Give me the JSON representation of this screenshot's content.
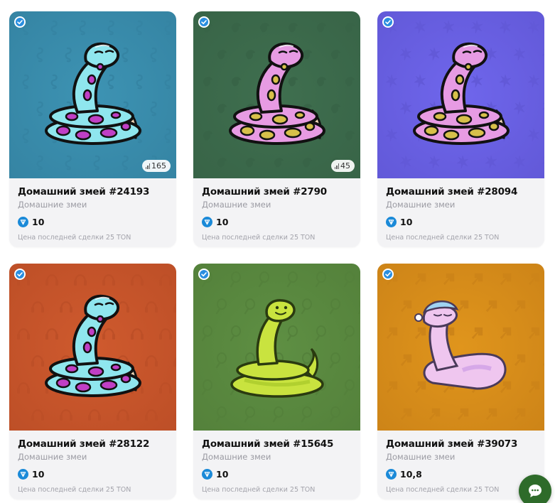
{
  "cards": [
    {
      "title": "Домашний змей #24193",
      "collection": "Домашние змеи",
      "price": "10",
      "last_deal": "Цена последней сделки 25 TON",
      "views": "165",
      "bg_color": "#3d93b3",
      "bg_pattern_color": "#3584a3",
      "snake_body": "#8fe6ee",
      "snake_spots": "#c03fc5",
      "snake_style": "coil",
      "pattern_icon": "seahorse-icon"
    },
    {
      "title": "Домашний змей #2790",
      "collection": "Домашние змеи",
      "price": "10",
      "last_deal": "Цена последней сделки 25 TON",
      "views": "45",
      "bg_color": "#3f6f4f",
      "bg_pattern_color": "#386447",
      "snake_body": "#e79be3",
      "snake_spots": "#d7c04a",
      "snake_style": "coil",
      "pattern_icon": "parrot-icon"
    },
    {
      "title": "Домашний змей #28094",
      "collection": "Домашние змеи",
      "price": "10",
      "last_deal": "Цена последней сделки 25 TON",
      "views": "",
      "bg_color": "#6f66ec",
      "bg_pattern_color": "#6259d8",
      "snake_body": "#e79be3",
      "snake_spots": "#d7c04a",
      "snake_style": "coil",
      "pattern_icon": "leaf-icon"
    },
    {
      "title": "Домашний змей #28122",
      "collection": "Домашние змеи",
      "price": "10",
      "last_deal": "Цена последней сделки 25 TON",
      "views": "",
      "bg_color": "#cf5a2e",
      "bg_pattern_color": "#bd4f27",
      "snake_body": "#8fe6ee",
      "snake_spots": "#c03fc5",
      "snake_style": "coil",
      "pattern_icon": "headphones-icon"
    },
    {
      "title": "Домашний змей #15645",
      "collection": "Домашние змеи",
      "price": "10",
      "last_deal": "Цена последней сделки 25 TON",
      "views": "",
      "bg_color": "#5e8f43",
      "bg_pattern_color": "#54813b",
      "snake_body": "#c9e33f",
      "snake_spots": "#a6c72a",
      "snake_style": "plain",
      "pattern_icon": "racket-icon"
    },
    {
      "title": "Домашний змей #39073",
      "collection": "Домашние змеи",
      "price": "10,8",
      "last_deal": "Цена последней сделки 25 TON",
      "views": "",
      "bg_color": "#e0951c",
      "bg_pattern_color": "#cd8418",
      "snake_body": "#efc6ef",
      "snake_spots": "#cfa0e6",
      "snake_style": "sleep",
      "pattern_icon": "arrow-icon"
    }
  ],
  "chat_icon": "chat-bubble-icon",
  "verify_icon": "verified-badge-icon",
  "currency_icon": "ton-icon"
}
